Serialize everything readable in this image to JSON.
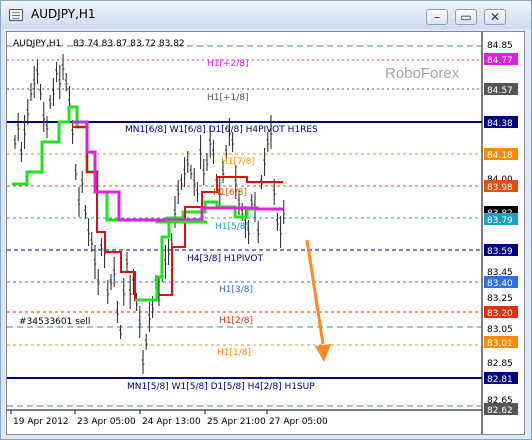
{
  "window": {
    "title": "AUDJPY,H1",
    "minimize_glyph": "–",
    "restore_glyph": "▭",
    "close_glyph": "✕"
  },
  "chart": {
    "symbol_info": "AUDJPY,H1",
    "ohlc": "83.74 83.87 83.72 83.82",
    "watermark": "RoboForex",
    "order_label": "#34533601 sell",
    "level_labels": [
      {
        "text": "H1[+2/8]",
        "color": "#e020e0"
      },
      {
        "text": "H1[+1/8]",
        "color": "#555555"
      },
      {
        "text": "MN1[6/8] W1[6/8] D1[6/8] H4PIVOT H1RES",
        "color": "#000080"
      },
      {
        "text": "H1[7/8]",
        "color": "#ff8c00"
      },
      {
        "text": "H1[6/8]",
        "color": "#e05010"
      },
      {
        "text": "H1[5/8]",
        "color": "#20a0c0"
      },
      {
        "text": "H4[3/8] H1PIVOT",
        "color": "#000080"
      },
      {
        "text": "H1[3/8]",
        "color": "#3070e0"
      },
      {
        "text": "H1[2/8]",
        "color": "#e03010"
      },
      {
        "text": "H1[1/8]",
        "color": "#ff8c00"
      },
      {
        "text": "MN1[5/8] W1[5/8] D1[5/8] H4[2/8] H1SUP",
        "color": "#000080"
      }
    ],
    "price_labels": [
      {
        "text": "84.85",
        "boxed": false
      },
      {
        "text": "84.77",
        "boxed": true,
        "bg": "#e020e0"
      },
      {
        "text": "84.57",
        "boxed": true,
        "bg": "#555555"
      },
      {
        "text": "84.38",
        "boxed": true,
        "bg": "#000080"
      },
      {
        "text": "84.18",
        "boxed": true,
        "bg": "#ff8c00"
      },
      {
        "text": "84.00",
        "boxed": false
      },
      {
        "text": "83.98",
        "boxed": true,
        "bg": "#e05010"
      },
      {
        "text": "83.82",
        "boxed": true,
        "bg": "#000000"
      },
      {
        "text": "83.79",
        "boxed": true,
        "bg": "#20a0c0"
      },
      {
        "text": "83.59",
        "boxed": true,
        "bg": "#000080"
      },
      {
        "text": "83.45",
        "boxed": false
      },
      {
        "text": "83.40",
        "boxed": true,
        "bg": "#3070e0"
      },
      {
        "text": "83.25",
        "boxed": false
      },
      {
        "text": "83.20",
        "boxed": true,
        "bg": "#e03010"
      },
      {
        "text": "83.05",
        "boxed": false
      },
      {
        "text": "83.01",
        "boxed": true,
        "bg": "#ff8c00"
      },
      {
        "text": "82.85",
        "boxed": false
      },
      {
        "text": "82.81",
        "boxed": true,
        "bg": "#000080"
      },
      {
        "text": "82.65",
        "boxed": false
      },
      {
        "text": "82.62",
        "boxed": true,
        "bg": "#555555"
      }
    ],
    "time_labels": [
      "19 Apr 2012",
      "23 Apr 05:00",
      "24 Apr 13:00",
      "25 Apr 21:00",
      "27 Apr 05:00"
    ]
  }
}
